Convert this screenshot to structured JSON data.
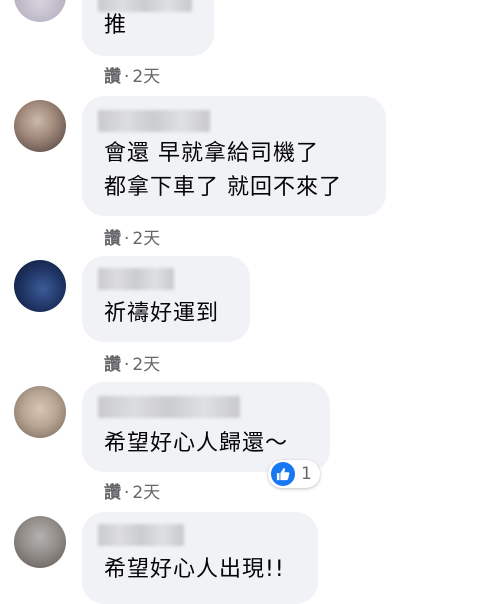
{
  "comments": [
    {
      "text_lines": [
        "推"
      ],
      "like_label": "讚",
      "separator": "·",
      "time": "2天"
    },
    {
      "text_lines": [
        "會還 早就拿給司機了",
        "都拿下車了 就回不來了"
      ],
      "like_label": "讚",
      "separator": "·",
      "time": "2天"
    },
    {
      "text_lines": [
        "祈禱好運到"
      ],
      "like_label": "讚",
      "separator": "·",
      "time": "2天"
    },
    {
      "text_lines": [
        "希望好心人歸還～"
      ],
      "like_label": "讚",
      "separator": "·",
      "time": "2天",
      "reaction": {
        "icon": "like-icon",
        "count": "1",
        "color": "#1877f2"
      }
    },
    {
      "text_lines": [
        "希望好心人出現!!"
      ]
    }
  ],
  "colors": {
    "bubble": "#f0f2f5",
    "meta": "#65676b",
    "like_blue": "#1877f2"
  }
}
